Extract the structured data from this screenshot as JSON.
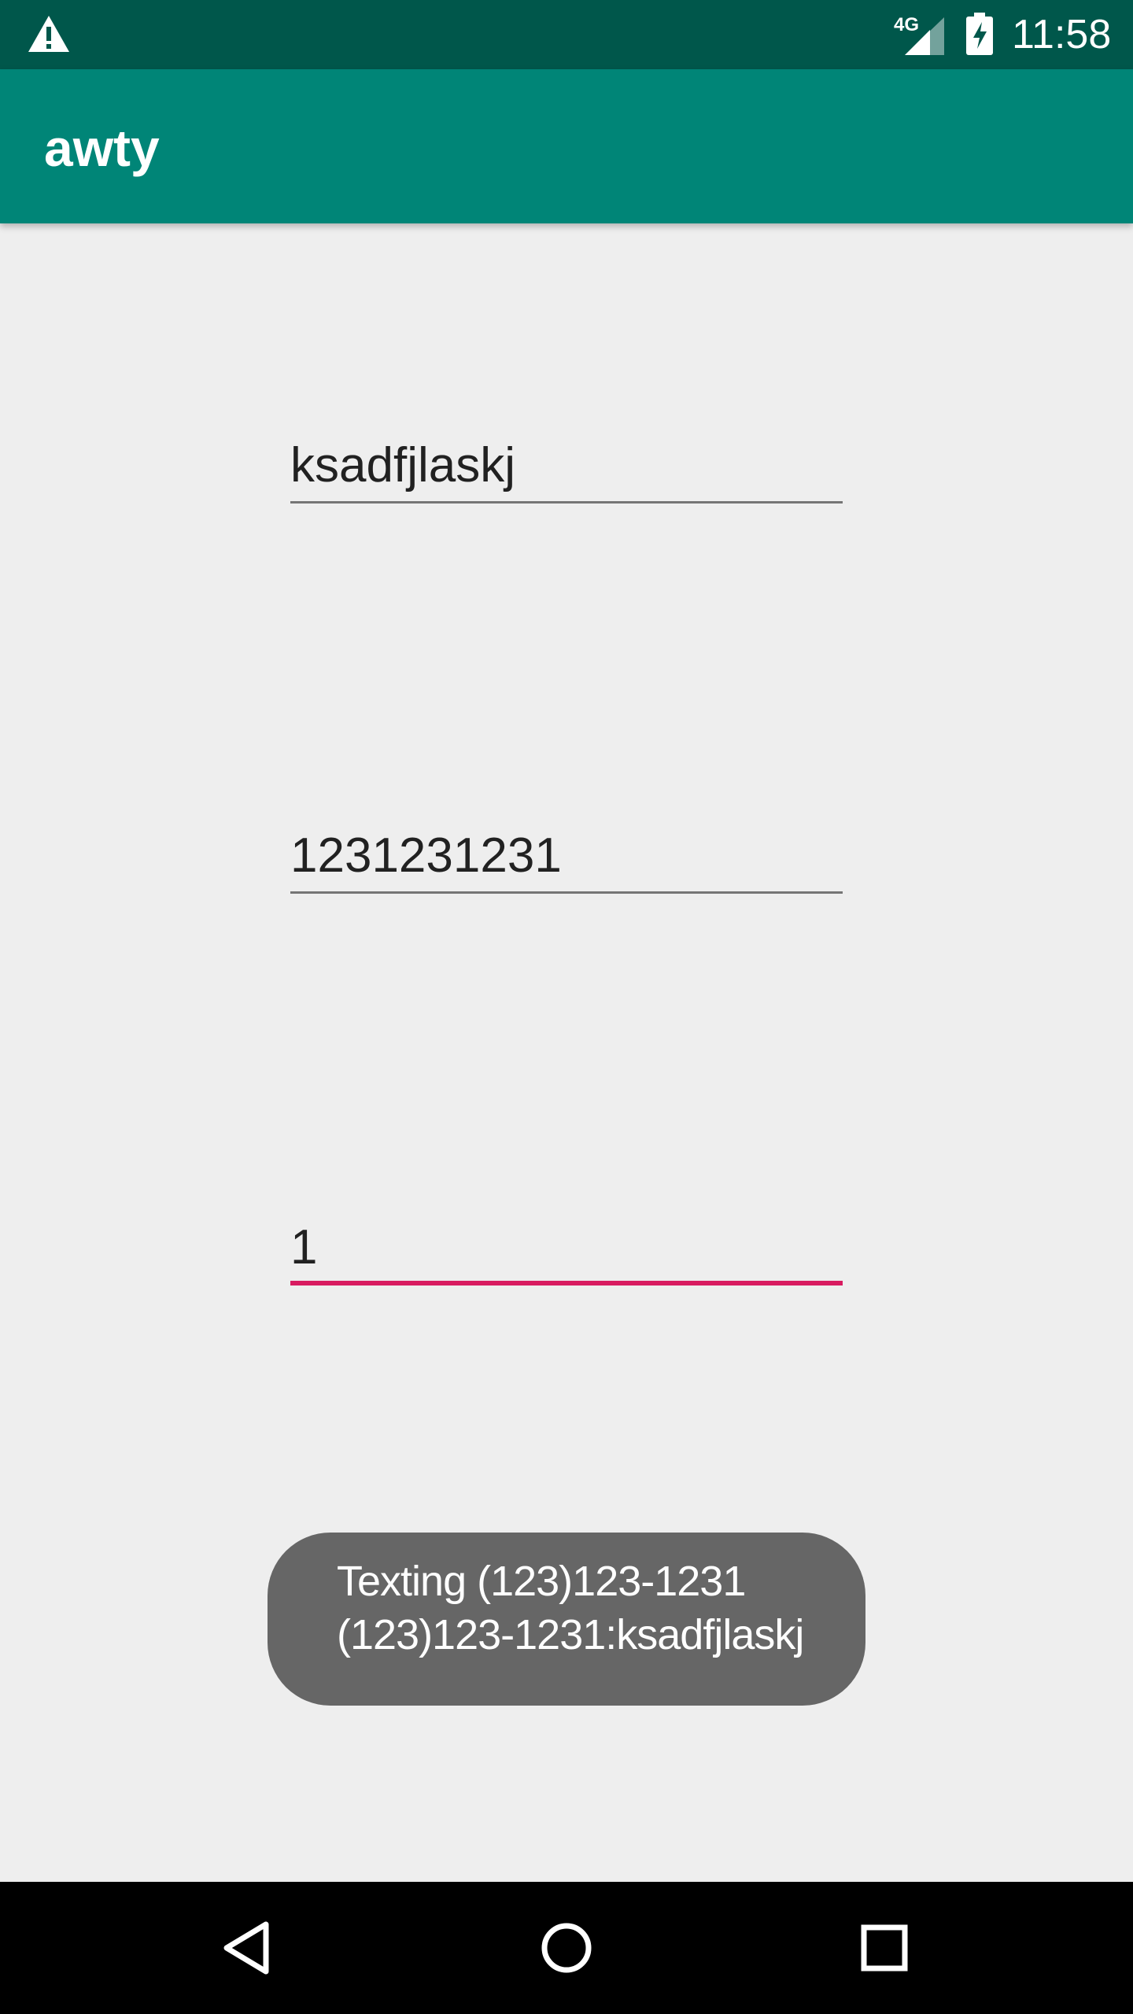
{
  "status_bar": {
    "network": "4G",
    "time": "11:58",
    "icons": [
      "warning-icon",
      "signal-icon",
      "battery-charging-icon"
    ]
  },
  "app_bar": {
    "title": "awty"
  },
  "form": {
    "message_value": "ksadfjlaskj",
    "phone_value": "1231231231",
    "interval_value": "1"
  },
  "toast": {
    "line1": "Texting (123)123-1231",
    "line2": "(123)123-1231:ksadfjlaskj"
  },
  "nav_bar": {
    "icons": [
      "back-icon",
      "home-icon",
      "recents-icon"
    ]
  },
  "colors": {
    "status_bar": "#00574b",
    "app_bar": "#008577",
    "accent": "#d81b60",
    "background": "#eeeeee",
    "toast": "#666666"
  }
}
